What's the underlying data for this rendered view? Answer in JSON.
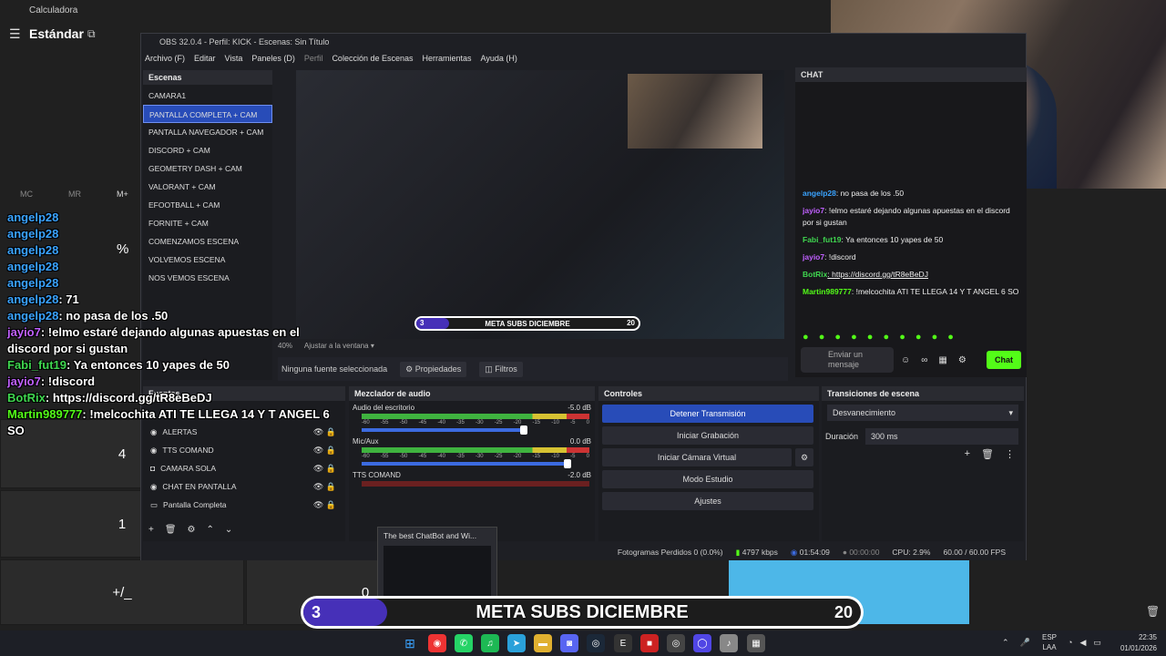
{
  "calculator": {
    "title": "Calculadora",
    "mode": "Estándar",
    "memory": [
      "MC",
      "MR",
      "M+"
    ],
    "keys": [
      "4",
      "1",
      "+/_",
      "0",
      "%"
    ]
  },
  "obs": {
    "title": "OBS 32.0.4 - Perfil: KICK - Escenas: Sin Título",
    "menu": [
      "Archivo (F)",
      "Editar",
      "Vista",
      "Paneles (D)",
      "Perfil",
      "Colección de Escenas",
      "Herramientas",
      "Ayuda (H)"
    ],
    "scenes_title": "Escenas",
    "scenes": [
      "CAMARA1",
      "PANTALLA COMPLETA + CAM",
      "PANTALLA NAVEGADOR + CAM",
      "DISCORD + CAM",
      "GEOMETRY DASH + CAM",
      "VALORANT + CAM",
      "EFOOTBALL + CAM",
      "FORNITE + CAM",
      "COMENZAMOS ESCENA",
      "VOLVEMOS ESCENA",
      "NOS VEMOS ESCENA"
    ],
    "zoom": "40%",
    "fit_label": "Ajustar a la ventana",
    "no_source": "Ninguna fuente seleccionada",
    "properties": "Propiedades",
    "filters": "Filtros",
    "sources_title": "Fuentes",
    "sources": [
      "ALERTAS",
      "TTS COMAND",
      "CAMARA SOLA",
      "CHAT EN PANTALLA",
      "Pantalla Completa"
    ],
    "mixer_title": "Mezclador de audio",
    "mixer": [
      {
        "name": "Audio del escritorio",
        "db": "-5.0 dB"
      },
      {
        "name": "Mic/Aux",
        "db": "0.0 dB"
      },
      {
        "name": "TTS COMAND",
        "db": "-2.0 dB"
      }
    ],
    "scale": [
      "-60",
      "-55",
      "-50",
      "-45",
      "-40",
      "-35",
      "-30",
      "-25",
      "-20",
      "-15",
      "-10",
      "-5",
      "0"
    ],
    "controls_title": "Controles",
    "controls": [
      "Detener Transmisión",
      "Iniciar Grabación",
      "Iniciar Cámara Virtual",
      "Modo Estudio",
      "Ajustes"
    ],
    "transitions_title": "Transiciones de escena",
    "transition": "Desvanecimiento",
    "duration_label": "Duración",
    "duration": "300 ms",
    "status": {
      "dropped": "Fotogramas Perdidos 0 (0.0%)",
      "kbps": "4797 kbps",
      "live_time": "01:54:09",
      "rec_time": "00:00:00",
      "cpu": "CPU: 2.9%",
      "fps": "60.00 / 60.00 FPS"
    }
  },
  "chat": {
    "title": "CHAT",
    "messages": [
      {
        "user": "angelp28",
        "text": ": no pasa de los .50"
      },
      {
        "user": "jayio7",
        "text": ": !elmo estaré dejando algunas apuestas en el discord por si gustan"
      },
      {
        "user": "Fabi_fut19",
        "text": ": Ya entonces 10 yapes de 50"
      },
      {
        "user": "jayio7",
        "text": ": !discord"
      },
      {
        "user": "BotRix",
        "text": ": https://discord.gg/tR8eBeDJ"
      },
      {
        "user": "Martin989777",
        "text": ": !melcochita ATI TE LLEGA 14 Y T ANGEL 6 SO"
      }
    ],
    "input_placeholder": "Enviar un mensaje",
    "send_label": "Chat"
  },
  "overlay_chat": [
    {
      "user": "angelp28",
      "text": ""
    },
    {
      "user": "angelp28",
      "text": ""
    },
    {
      "user": "angelp28",
      "text": ""
    },
    {
      "user": "angelp28",
      "text": ""
    },
    {
      "user": "angelp28",
      "text": ""
    },
    {
      "user": "angelp28",
      "text": ": 71"
    },
    {
      "user": "angelp28",
      "text": ": no pasa de los .50"
    },
    {
      "user": "jayio7",
      "text": ": !elmo estaré dejando algunas apuestas en el discord por si gustan"
    },
    {
      "user": "Fabi_fut19",
      "text": ": Ya entonces 10 yapes de 50"
    },
    {
      "user": "jayio7",
      "text": ": !discord"
    },
    {
      "user": "BotRix",
      "text": ": https://discord.gg/tR8eBeDJ"
    },
    {
      "user": "Martin989777",
      "text": ": !melcochita ATI TE LLEGA 14 Y T ANGEL 6 SO"
    }
  ],
  "subs": {
    "label": "META SUBS DICIEMBRE",
    "current": "3",
    "goal": "20",
    "progress": 0.15
  },
  "taskbar": {
    "popup": "The best ChatBot and Wi...",
    "lang": "ESP",
    "layout": "LAA",
    "time": "22:35",
    "date": "01/01/2026"
  },
  "colors": {
    "accent": "#284cb8",
    "kick_green": "#53fc18",
    "subs_purple": "#4630b8"
  }
}
